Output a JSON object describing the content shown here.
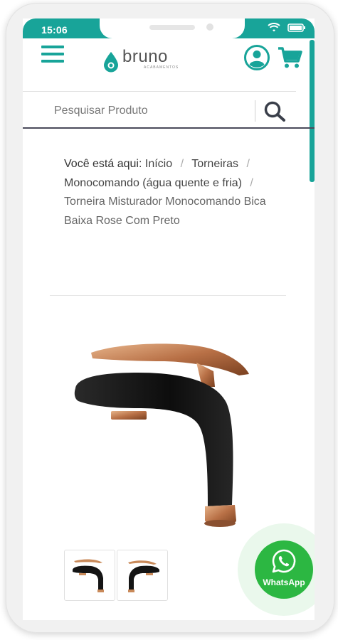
{
  "status_bar": {
    "time": "15:06"
  },
  "brand": {
    "name": "bruno",
    "tagline": "ACABAMENTOS"
  },
  "search": {
    "placeholder": "Pesquisar Produto",
    "value": ""
  },
  "breadcrumb": {
    "label": "Você está aqui:",
    "items": [
      "Início",
      "Torneiras",
      "Monocomando (água quente e fria)",
      "Torneira Misturador Monocomando Bica Baixa Rose Com Preto"
    ],
    "separator": "/"
  },
  "product": {
    "thumbnail_count": 2
  },
  "whatsapp": {
    "label": "WhatsApp"
  },
  "colors": {
    "brand_teal": "#18a499",
    "whatsapp_green": "#2cb742",
    "faucet_black": "#141414",
    "rose_gold": "#c98a5a"
  },
  "icons": {
    "menu": "menu-icon",
    "account": "user-icon",
    "cart": "cart-icon",
    "search": "search-icon",
    "whatsapp": "whatsapp-icon"
  }
}
